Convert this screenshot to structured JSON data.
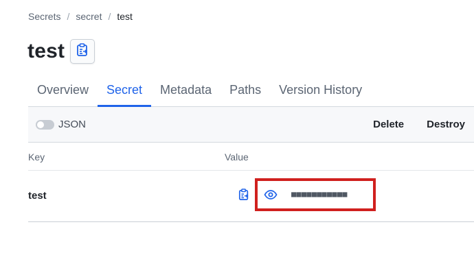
{
  "breadcrumb": {
    "items": [
      "Secrets",
      "secret",
      "test"
    ],
    "separator": "/"
  },
  "page": {
    "title": "test",
    "copy_icon": "clipboard-icon"
  },
  "tabs": [
    {
      "label": "Overview",
      "active": false
    },
    {
      "label": "Secret",
      "active": true
    },
    {
      "label": "Metadata",
      "active": false
    },
    {
      "label": "Paths",
      "active": false
    },
    {
      "label": "Version History",
      "active": false
    }
  ],
  "toolbar": {
    "json_toggle_label": "JSON",
    "json_toggle_on": false,
    "delete_label": "Delete",
    "destroy_label": "Destroy"
  },
  "table": {
    "headers": {
      "key": "Key",
      "value": "Value"
    },
    "rows": [
      {
        "key": "test",
        "masked_value": "■■■■■■■■■■■",
        "copy_icon": "clipboard-icon",
        "reveal_icon": "eye-icon"
      }
    ]
  },
  "colors": {
    "accent": "#1f63e9",
    "highlight": "#d0201e",
    "text": "#1f2329",
    "muted": "#5b6573"
  }
}
